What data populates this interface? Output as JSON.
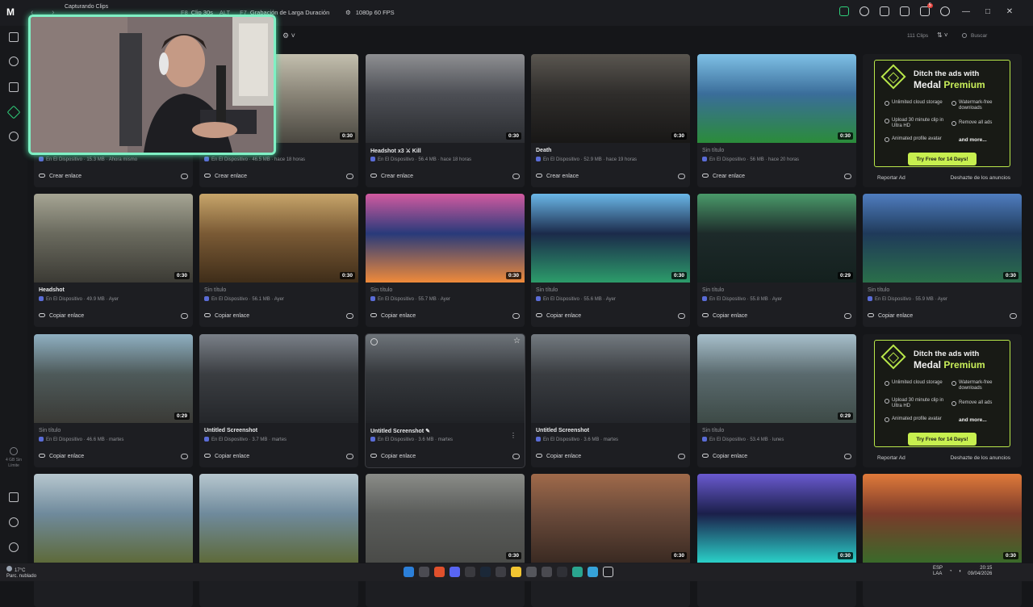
{
  "topbar": {
    "logo": "M",
    "capture_status": "Capturando Clips",
    "capture_sub": "",
    "hotkeys": [
      {
        "key": "F8",
        "label": "Clip 30s"
      },
      {
        "key": "ALT",
        "label": ""
      },
      {
        "key": "F7",
        "label": "Grabación de Larga Duración"
      }
    ],
    "quality": "1080p 60 FPS",
    "notifications_count": "5",
    "window_controls": [
      "—",
      "□",
      "✕"
    ]
  },
  "toolbar": {
    "clip_count": "111 Clips",
    "search_placeholder": "Buscar"
  },
  "sidebar": {
    "storage": "4 GB\nSin Límite"
  },
  "cards": [
    {
      "title": "",
      "meta": "En El Dispositivo · 15.3 MB · Ahora mismo",
      "action": "Crear enlace",
      "duration": ""
    },
    {
      "title": "",
      "meta": "En El Dispositivo · 46.5 MB · hace 18 horas",
      "action": "Crear enlace",
      "duration": "0:30"
    },
    {
      "title": "Headshot x3 ⚔ Kill",
      "meta": "En El Dispositivo · 56.4 MB · hace 18 horas",
      "action": "Crear enlace",
      "duration": "0:30"
    },
    {
      "title": "Death",
      "meta": "En El Dispositivo · 52.9 MB · hace 19 horas",
      "action": "Crear enlace",
      "duration": "0:30"
    },
    {
      "title": "Sin título",
      "meta": "En El Dispositivo · 56 MB · hace 20 horas",
      "action": "Crear enlace",
      "duration": "0:30"
    },
    {
      "title": "Headshot",
      "meta": "En El Dispositivo · 49.9 MB · Ayer",
      "action": "Copiar enlace",
      "duration": "0:30"
    },
    {
      "title": "Sin título",
      "meta": "En El Dispositivo · 56.1 MB · Ayer",
      "action": "Copiar enlace",
      "duration": "0:30"
    },
    {
      "title": "Sin título",
      "meta": "En El Dispositivo · 55.7 MB · Ayer",
      "action": "Copiar enlace",
      "duration": "0:30"
    },
    {
      "title": "Sin título",
      "meta": "En El Dispositivo · 55.6 MB · Ayer",
      "action": "Copiar enlace",
      "duration": "0:30"
    },
    {
      "title": "Sin título",
      "meta": "En El Dispositivo · 55.8 MB · Ayer",
      "action": "Copiar enlace",
      "duration": "0:29"
    },
    {
      "title": "Sin título",
      "meta": "En El Dispositivo · 55.9 MB · Ayer",
      "action": "Copiar enlace",
      "duration": "0:30"
    },
    {
      "title": "Sin título",
      "meta": "En El Dispositivo · 46.6 MB · martes",
      "action": "Copiar enlace",
      "duration": "0:29"
    },
    {
      "title": "Untitled Screenshot",
      "meta": "En El Dispositivo · 3.7 MB · martes",
      "action": "Copiar enlace",
      "duration": ""
    },
    {
      "title": "Untitled Screenshot ✎",
      "meta": "En El Dispositivo · 3.6 MB · martes",
      "action": "Copiar enlace",
      "duration": ""
    },
    {
      "title": "Untitled Screenshot",
      "meta": "En El Dispositivo · 3.6 MB · martes",
      "action": "Copiar enlace",
      "duration": ""
    },
    {
      "title": "Sin título",
      "meta": "En El Dispositivo · 53.4 MB · lunes",
      "action": "Copiar enlace",
      "duration": "0:29"
    },
    {
      "title": "",
      "meta": "",
      "action": "",
      "duration": ""
    },
    {
      "title": "",
      "meta": "",
      "action": "",
      "duration": ""
    },
    {
      "title": "",
      "meta": "",
      "action": "",
      "duration": "0:30"
    },
    {
      "title": "",
      "meta": "",
      "action": "",
      "duration": "0:30"
    },
    {
      "title": "",
      "meta": "",
      "action": "",
      "duration": "0:30"
    },
    {
      "title": "",
      "meta": "",
      "action": "",
      "duration": "0:30"
    }
  ],
  "ad": {
    "headline1": "Ditch the ads with",
    "headline2_a": "Medal ",
    "headline2_b": "Premium",
    "features": [
      "Unlimited cloud storage",
      "Watermark-free downloads",
      "Upload 30 minute clip in Ultra HD",
      "Remove all ads",
      "Animated profile avatar"
    ],
    "more": "and more...",
    "cta": "Try Free for 14 Days!",
    "report": "Reportar Ad",
    "remove": "Deshazte de los anuncios"
  },
  "taskbar": {
    "temp": "17°C",
    "weather": "Parc. nublado",
    "lang": "ESP\nLAA",
    "time": "20:15",
    "date": "09/04/2026"
  }
}
